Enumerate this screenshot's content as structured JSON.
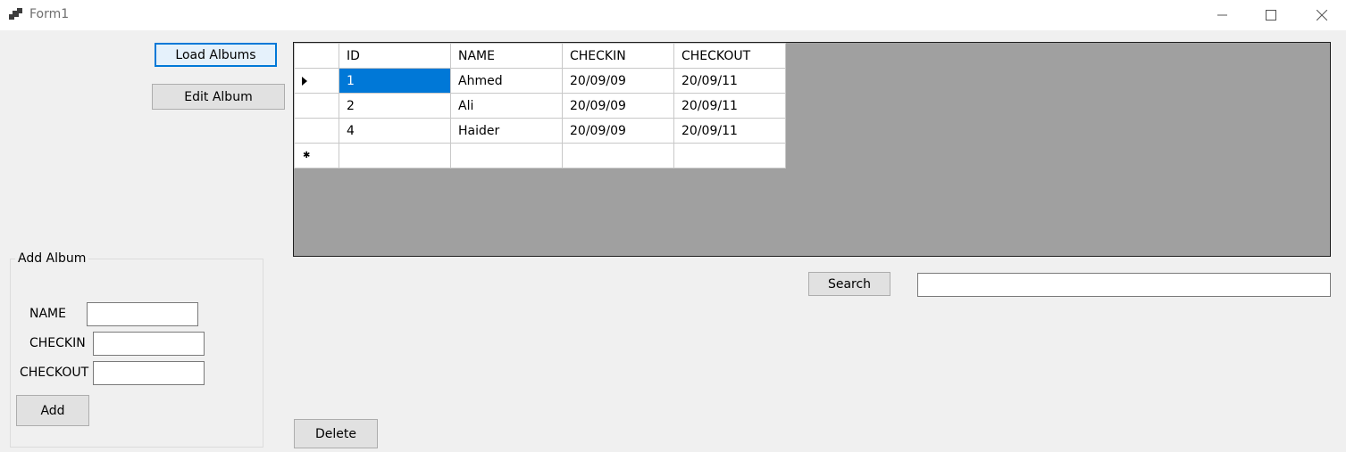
{
  "window": {
    "title": "Form1"
  },
  "buttons": {
    "load_albums": "Load Albums",
    "edit_album": "Edit Album",
    "search": "Search",
    "delete": "Delete",
    "add": "Add"
  },
  "grid": {
    "columns": [
      "ID",
      "NAME",
      "CHECKIN",
      "CHECKOUT"
    ],
    "rows": [
      [
        "1",
        "Ahmed",
        "20/09/09",
        "20/09/11"
      ],
      [
        "2",
        "Ali",
        "20/09/09",
        "20/09/11"
      ],
      [
        "4",
        "Haider",
        "20/09/09",
        "20/09/11"
      ]
    ],
    "selected_row_marker": "current-row-arrow",
    "new_row_marker": "new-row-star"
  },
  "search": {
    "value": ""
  },
  "add_group": {
    "title": "Add Album",
    "name_label": "NAME",
    "checkin_label": "CHECKIN",
    "checkout_label": "CHECKOUT",
    "name_value": "",
    "checkin_value": "",
    "checkout_value": ""
  },
  "colors": {
    "accent": "#0078d7",
    "form_bg": "#f0f0f0",
    "grid_bg": "#a0a0a0"
  }
}
